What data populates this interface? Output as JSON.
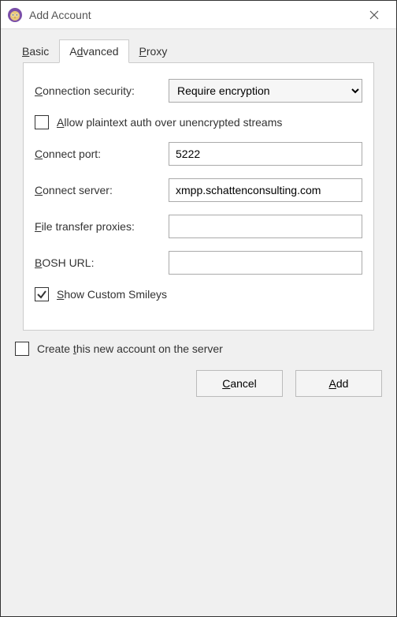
{
  "window": {
    "title": "Add Account"
  },
  "tabs": [
    {
      "label_pre": "",
      "key": "B",
      "label_post": "asic"
    },
    {
      "label_pre": "A",
      "key": "d",
      "label_post": "vanced"
    },
    {
      "label_pre": "",
      "key": "P",
      "label_post": "roxy"
    }
  ],
  "form": {
    "connection_security": {
      "label_pre": "",
      "label_key": "C",
      "label_post": "onnection security:",
      "value": "Require encryption"
    },
    "allow_plaintext": {
      "label_pre": "",
      "key": "A",
      "label_post": "llow plaintext auth over unencrypted streams",
      "checked": false
    },
    "connect_port": {
      "label_pre": "",
      "key": "C",
      "label_post": "onnect port:",
      "value": "5222"
    },
    "connect_server": {
      "label_pre": "",
      "key": "C",
      "label_post": "onnect server:",
      "value": "xmpp.schattenconsulting.com"
    },
    "file_transfer_proxies": {
      "label_pre": "",
      "key": "F",
      "label_post": "ile transfer proxies:",
      "value": ""
    },
    "bosh_url": {
      "label_pre": "",
      "key": "B",
      "label_post": "OSH URL:",
      "value": ""
    },
    "show_smileys": {
      "label_pre": "",
      "key": "S",
      "label_post": "how Custom Smileys",
      "checked": true
    }
  },
  "create_on_server": {
    "label_pre": "Create ",
    "key": "t",
    "label_post": "his new account on the server",
    "checked": false
  },
  "buttons": {
    "cancel": {
      "pre": "",
      "key": "C",
      "post": "ancel"
    },
    "add": {
      "pre": "",
      "key": "A",
      "post": "dd"
    }
  }
}
